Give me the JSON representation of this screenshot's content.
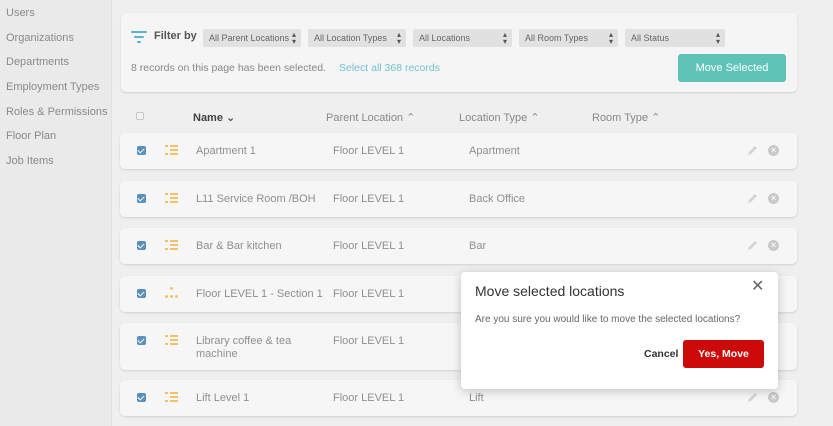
{
  "sidebar": {
    "items": [
      {
        "label": "Users"
      },
      {
        "label": "Organizations"
      },
      {
        "label": "Departments"
      },
      {
        "label": "Employment Types"
      },
      {
        "label": "Roles & Permissions"
      },
      {
        "label": "Floor Plan"
      },
      {
        "label": "Job Items"
      }
    ]
  },
  "filter": {
    "label": "Filter by",
    "selects": [
      {
        "value": "All Parent Locations"
      },
      {
        "value": "All Location Types"
      },
      {
        "value": "All Locations"
      },
      {
        "value": "All Room Types"
      },
      {
        "value": "All Status"
      }
    ],
    "records_text": "8 records on this page has been selected.",
    "select_all_link": "Select all 368 records",
    "move_button": "Move Selected"
  },
  "table": {
    "headers": {
      "name": "Name",
      "name_arrow": "⌄",
      "parent": "Parent Location",
      "type": "Location Type",
      "room": "Room Type",
      "up_arrow": "⌃"
    },
    "rows": [
      {
        "name": "Apartment 1",
        "parent": "Floor LEVEL 1",
        "type": "Apartment",
        "icon": "list-icon",
        "checked": true
      },
      {
        "name": "L11 Service Room /BOH",
        "parent": "Floor LEVEL 1",
        "type": "Back Office",
        "icon": "list-icon",
        "checked": true
      },
      {
        "name": "Bar & Bar kitchen",
        "parent": "Floor LEVEL 1",
        "type": "Bar",
        "icon": "list-icon",
        "checked": true
      },
      {
        "name": "Floor LEVEL 1 - Section 1",
        "parent": "Floor LEVEL 1",
        "type": "",
        "icon": "tree-icon",
        "checked": true
      },
      {
        "name": "Library coffee & tea machine",
        "parent": "Floor LEVEL 1",
        "type": "",
        "icon": "list-icon",
        "checked": true
      },
      {
        "name": "Lift Level 1",
        "parent": "Floor LEVEL 1",
        "type": "Lift",
        "icon": "list-icon",
        "checked": true
      }
    ]
  },
  "dialog": {
    "title": "Move selected locations",
    "message": "Are you sure you would like to move the selected locations?",
    "cancel_label": "Cancel",
    "confirm_label": "Yes, Move",
    "close_glyph": "✕"
  },
  "icons": {
    "filter": "filter-icon",
    "row_list": "list-icon",
    "row_tree": "tree-icon",
    "edit": "pencil-icon",
    "delete": "close-circle-icon",
    "select_arrows": "chevron-updown-icon"
  },
  "colors": {
    "accent_teal": "#5dc4b6",
    "link": "#73c2cf",
    "checkbox": "#5a8fbe",
    "row_icon": "#f0c36a",
    "danger": "#cc0a0a"
  }
}
